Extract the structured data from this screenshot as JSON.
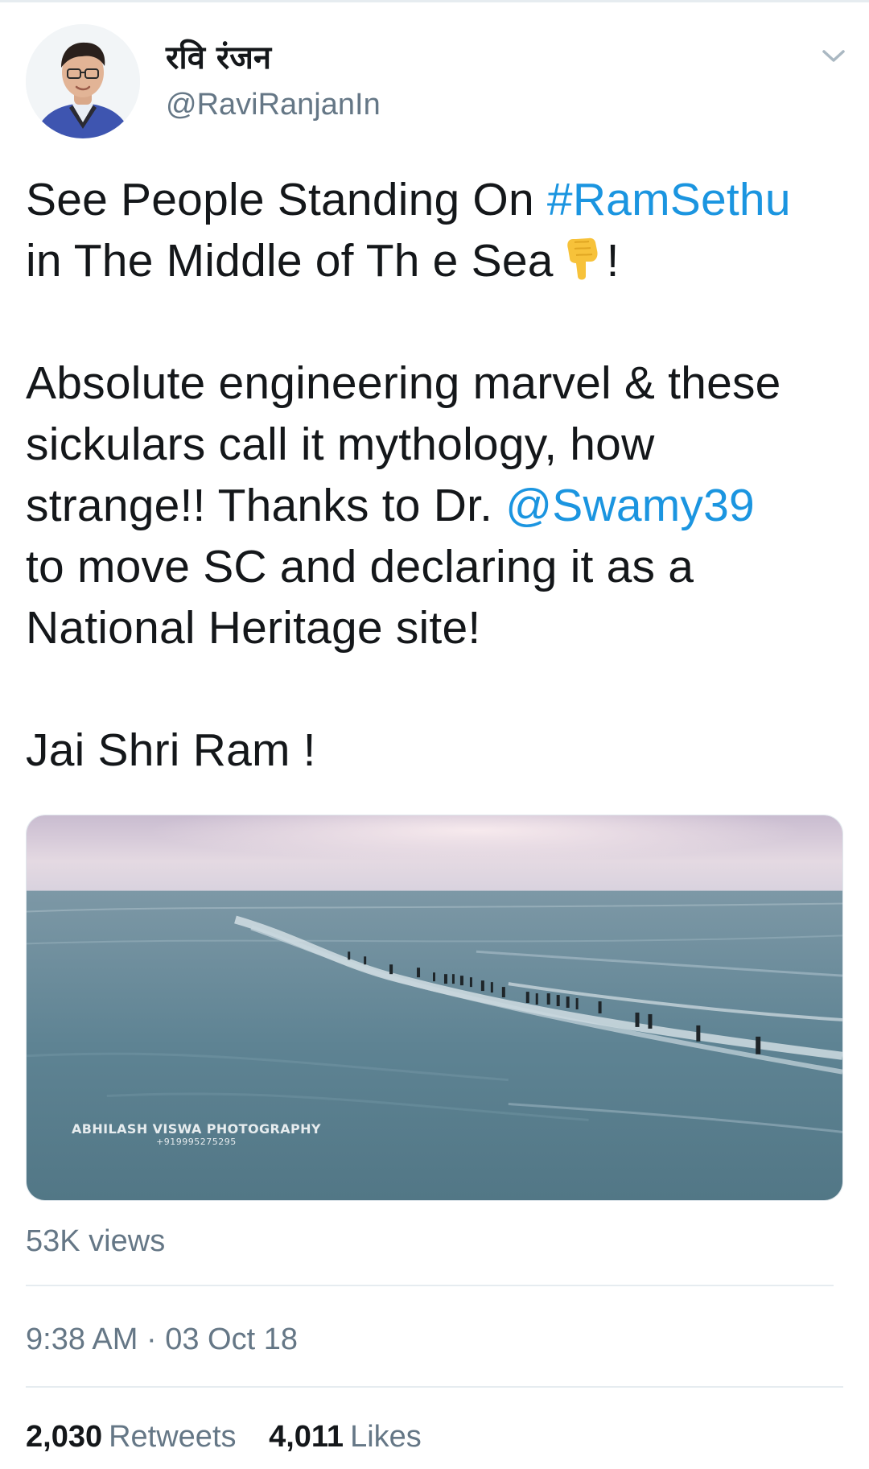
{
  "user": {
    "display_name": "रवि रंजन",
    "handle": "@RaviRanjanIn"
  },
  "menu": {
    "icon": "chevron-down-icon"
  },
  "tweet": {
    "line1_pre": "See People Standing On ",
    "line1_hashtag": "#RamSethu",
    "line2_pre": "in The Middle of Th e Sea",
    "line2_emoji": "backhand-index-pointing-down-emoji",
    "line2_post": "!",
    "line3": "Absolute engineering marvel & these",
    "line4": "sickulars call it mythology, how",
    "line5_pre": "strange!! Thanks to Dr. ",
    "line5_mention": "@Swamy39",
    "line6": "to move SC and declaring it as a",
    "line7": "National Heritage site!",
    "line8": "Jai Shri Ram !"
  },
  "media": {
    "watermark_line1": "ABHILASH VISWA PHOTOGRAPHY",
    "watermark_line2": "+919995275295"
  },
  "views": "53K views",
  "timestamp": "9:38 AM · 03 Oct 18",
  "stats": {
    "retweets_count": "2,030",
    "retweets_label": "Retweets",
    "likes_count": "4,011",
    "likes_label": "Likes"
  },
  "colors": {
    "link": "#1b95e0",
    "secondary_text": "#657786",
    "primary_text": "#14171a",
    "divider": "#e6ecf0"
  }
}
